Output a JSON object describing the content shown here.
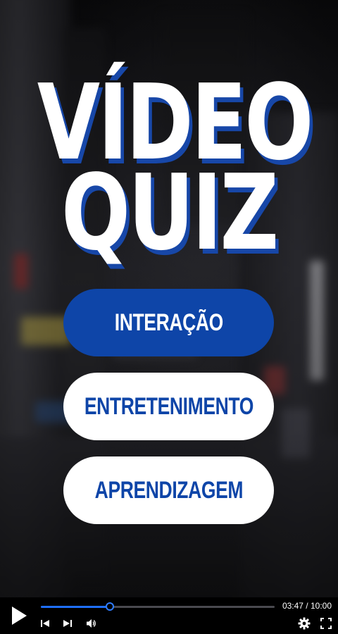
{
  "title": {
    "line1": "VÍDEO",
    "line2": "QUIZ"
  },
  "options": [
    {
      "label": "INTERAÇÃO",
      "selected": true
    },
    {
      "label": "ENTRETENIMENTO",
      "selected": false
    },
    {
      "label": "APRENDIZAGEM",
      "selected": false
    }
  ],
  "player": {
    "current_time": "03:47",
    "duration": "10:00",
    "time_display": "03:47 / 10:00",
    "progress": 0.295,
    "icons": {
      "play": "play-icon",
      "previous": "skip-previous-icon",
      "next": "skip-next-icon",
      "volume": "volume-icon",
      "settings": "gear-icon",
      "fullscreen": "fullscreen-icon"
    }
  },
  "colors": {
    "accent_blue": "#0e45a8",
    "title_shadow": "#1747a8",
    "progress_blue": "#1f6fff",
    "white": "#ffffff"
  }
}
